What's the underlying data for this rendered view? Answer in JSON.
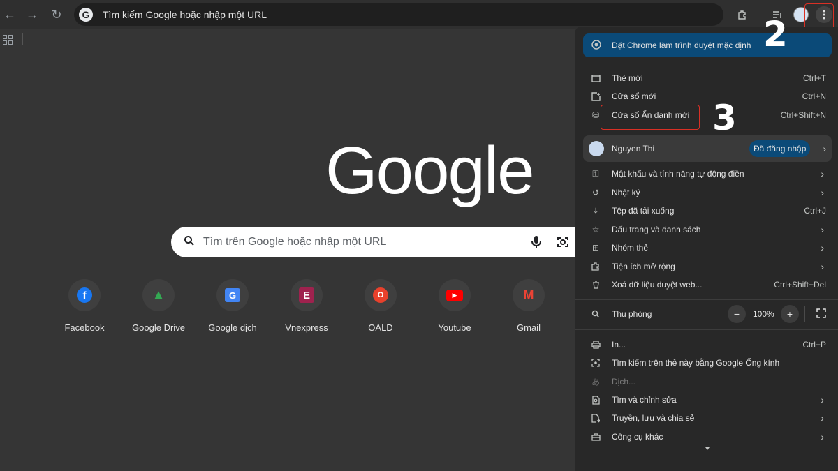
{
  "omnibox": {
    "text": "Tìm kiếm Google hoặc nhập một URL",
    "icon": "G"
  },
  "logo": "Google",
  "search": {
    "placeholder": "Tìm trên Google hoặc nhập một URL"
  },
  "shortcuts": [
    {
      "label": "Facebook",
      "icon": "facebook-icon",
      "color": "#1877f2",
      "glyph": "f"
    },
    {
      "label": "Google Drive",
      "icon": "google-drive-icon",
      "color": "#34a853",
      "glyph": "▲"
    },
    {
      "label": "Google dịch",
      "icon": "google-translate-icon",
      "color": "#4285f4",
      "glyph": "G"
    },
    {
      "label": "Vnexpress",
      "icon": "vnexpress-icon",
      "color": "#9f224e",
      "glyph": "E"
    },
    {
      "label": "OALD",
      "icon": "oald-icon",
      "color": "#e8412c",
      "glyph": "O"
    },
    {
      "label": "Youtube",
      "icon": "youtube-icon",
      "color": "#ff0000",
      "glyph": "▶"
    },
    {
      "label": "Gmail",
      "icon": "gmail-icon",
      "color": "#ea4335",
      "glyph": "M"
    }
  ],
  "menu": {
    "default_banner": "Đặt Chrome làm trình duyệt mặc định",
    "new_tab": {
      "label": "Thẻ mới",
      "shortcut": "Ctrl+T"
    },
    "new_window": {
      "label": "Cửa sổ mới",
      "shortcut": "Ctrl+N"
    },
    "incognito": {
      "label": "Cửa sổ Ẩn danh mới",
      "shortcut": "Ctrl+Shift+N"
    },
    "profile": {
      "name": "Nguyen Thi",
      "badge": "Đã đăng nhập"
    },
    "passwords": {
      "label": "Mật khẩu và tính năng tự động điền"
    },
    "history": {
      "label": "Nhật ký"
    },
    "downloads": {
      "label": "Tệp đã tải xuống",
      "shortcut": "Ctrl+J"
    },
    "bookmarks": {
      "label": "Dấu trang và danh sách"
    },
    "tab_groups": {
      "label": "Nhóm thẻ"
    },
    "extensions": {
      "label": "Tiện ích mở rộng"
    },
    "clear_data": {
      "label": "Xoá dữ liệu duyệt web...",
      "shortcut": "Ctrl+Shift+Del"
    },
    "zoom": {
      "label": "Thu phóng",
      "value": "100%",
      "minus": "−",
      "plus": "+"
    },
    "print": {
      "label": "In...",
      "shortcut": "Ctrl+P"
    },
    "lens": {
      "label": "Tìm kiếm trên thẻ này bằng Google Ống kính"
    },
    "translate": {
      "label": "Dịch..."
    },
    "find_edit": {
      "label": "Tìm và chỉnh sửa"
    },
    "cast_save_share": {
      "label": "Truyền, lưu và chia sẻ"
    },
    "more_tools": {
      "label": "Công cụ khác"
    }
  },
  "annotations": {
    "step2": "2",
    "step3": "3"
  },
  "colors": {
    "annotation_box": "#d93025",
    "banner": "#0b4a78"
  }
}
